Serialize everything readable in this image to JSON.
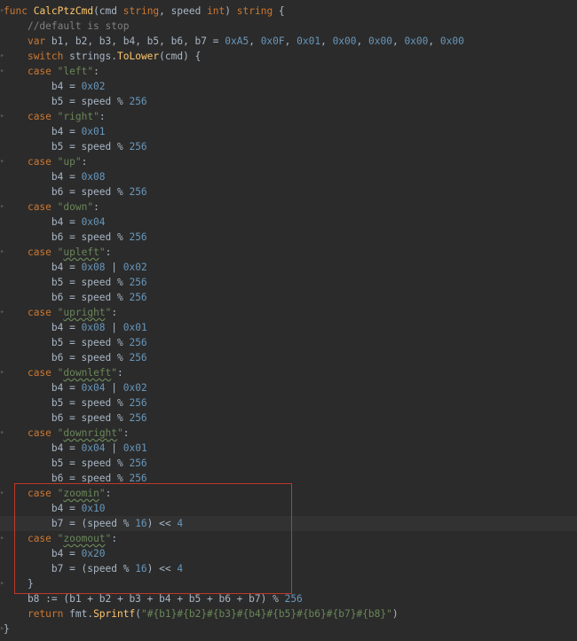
{
  "editor": {
    "lines": [
      {
        "t": "func CalcPtzCmd(cmd string, speed int) string {"
      },
      {
        "t": "    //default is stop"
      },
      {
        "t": "    var b1, b2, b3, b4, b5, b6, b7 = 0xA5, 0x0F, 0x01, 0x00, 0x00, 0x00, 0x00"
      },
      {
        "t": "    switch strings.ToLower(cmd) {"
      },
      {
        "t": "    case \"left\":"
      },
      {
        "t": "        b4 = 0x02"
      },
      {
        "t": "        b5 = speed % 256"
      },
      {
        "t": "    case \"right\":"
      },
      {
        "t": "        b4 = 0x01"
      },
      {
        "t": "        b5 = speed % 256"
      },
      {
        "t": "    case \"up\":"
      },
      {
        "t": "        b4 = 0x08"
      },
      {
        "t": "        b6 = speed % 256"
      },
      {
        "t": "    case \"down\":"
      },
      {
        "t": "        b4 = 0x04"
      },
      {
        "t": "        b6 = speed % 256"
      },
      {
        "t": "    case \"upleft\":"
      },
      {
        "t": "        b4 = 0x08 | 0x02"
      },
      {
        "t": "        b5 = speed % 256"
      },
      {
        "t": "        b6 = speed % 256"
      },
      {
        "t": "    case \"upright\":"
      },
      {
        "t": "        b4 = 0x08 | 0x01"
      },
      {
        "t": "        b5 = speed % 256"
      },
      {
        "t": "        b6 = speed % 256"
      },
      {
        "t": "    case \"downleft\":"
      },
      {
        "t": "        b4 = 0x04 | 0x02"
      },
      {
        "t": "        b5 = speed % 256"
      },
      {
        "t": "        b6 = speed % 256"
      },
      {
        "t": "    case \"downright\":"
      },
      {
        "t": "        b4 = 0x04 | 0x01"
      },
      {
        "t": "        b5 = speed % 256"
      },
      {
        "t": "        b6 = speed % 256"
      },
      {
        "t": "    case \"zoomin\":"
      },
      {
        "t": "        b4 = 0x10"
      },
      {
        "t": "        b7 = (speed % 16) << 4"
      },
      {
        "t": "    case \"zoomout\":"
      },
      {
        "t": "        b4 = 0x20"
      },
      {
        "t": "        b7 = (speed % 16) << 4"
      },
      {
        "t": "    }"
      },
      {
        "t": "    b8 := (b1 + b2 + b3 + b4 + b5 + b6 + b7) % 256"
      },
      {
        "t": "    return fmt.Sprintf(\"#{b1}#{b2}#{b3}#{b4}#{b5}#{b6}#{b7}#{b8}\")"
      },
      {
        "t": "}"
      }
    ]
  },
  "colors": {
    "background": "#2b2b2b",
    "current_line": "#323232",
    "selection_border": "#c0392b",
    "keyword": "#cc7832",
    "function": "#ffc66d",
    "number": "#6897bb",
    "string": "#6a8759",
    "comment": "#808080",
    "text": "#a9b7c6"
  }
}
